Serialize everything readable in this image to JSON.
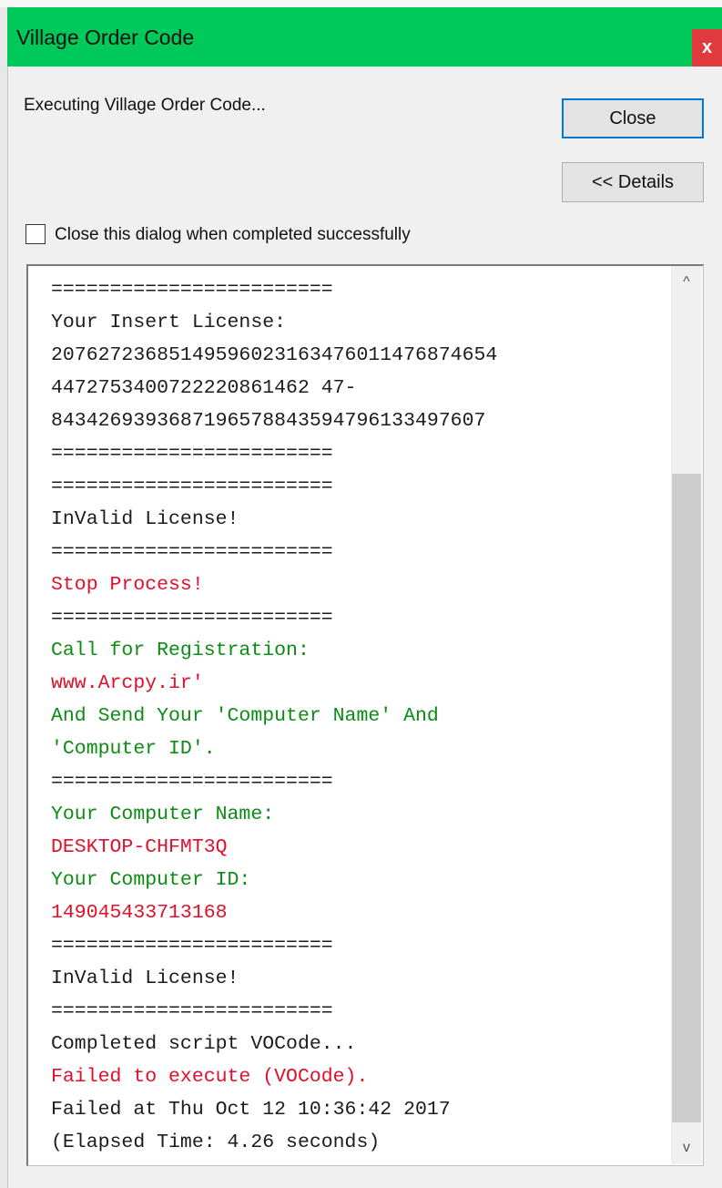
{
  "dialog": {
    "title": "Village Order Code",
    "close_glyph": "x",
    "status": "Executing Village Order Code...",
    "close_button": "Close",
    "details_button": "<< Details",
    "checkbox_label": "Close this dialog when completed successfully",
    "checkbox_checked": false
  },
  "colors": {
    "titlebar": "#00c95c",
    "close_x": "#e0393e",
    "log_red": "#e0102a",
    "log_green": "#0b8c13",
    "log_dark": "#1c1c1c"
  },
  "log": {
    "lines": [
      {
        "text": "========================",
        "color": "dark"
      },
      {
        "text": "Your Insert License:",
        "color": "dark"
      },
      {
        "text": "20762723685149596023163476011476874654",
        "color": "dark"
      },
      {
        "text": "4472753400722220861462 47-",
        "color": "dark"
      },
      {
        "text": "8434269393687196578843594796133497607",
        "color": "dark"
      },
      {
        "text": "========================",
        "color": "dark"
      },
      {
        "text": "========================",
        "color": "dark"
      },
      {
        "text": "InValid License!",
        "color": "dark"
      },
      {
        "text": "========================",
        "color": "dark"
      },
      {
        "text": "Stop Process!",
        "color": "red"
      },
      {
        "text": "========================",
        "color": "dark"
      },
      {
        "text": "Call for Registration:",
        "color": "green"
      },
      {
        "text": "www.Arcpy.ir'",
        "color": "red"
      },
      {
        "text": "And Send Your 'Computer Name' And",
        "color": "green"
      },
      {
        "text": "'Computer ID'.",
        "color": "green"
      },
      {
        "text": "========================",
        "color": "dark"
      },
      {
        "text": "Your Computer Name:",
        "color": "green"
      },
      {
        "text": "DESKTOP-CHFMT3Q",
        "color": "red"
      },
      {
        "text": "Your Computer ID:",
        "color": "green"
      },
      {
        "text": "149045433713168",
        "color": "red"
      },
      {
        "text": "========================",
        "color": "dark"
      },
      {
        "text": "InValid License!",
        "color": "dark"
      },
      {
        "text": "========================",
        "color": "dark"
      },
      {
        "text": "Completed script VOCode...",
        "color": "dark"
      },
      {
        "text": "Failed to execute (VOCode).",
        "color": "red"
      },
      {
        "text": "Failed at Thu Oct 12 10:36:42 2017",
        "color": "dark"
      },
      {
        "text": "(Elapsed Time: 4.26 seconds)",
        "color": "dark"
      }
    ]
  },
  "scrollbar": {
    "up_icon": "chevron-up-icon",
    "down_icon": "chevron-down-icon",
    "up_glyph": "^",
    "down_glyph": "v",
    "position_fraction": 1.0
  }
}
